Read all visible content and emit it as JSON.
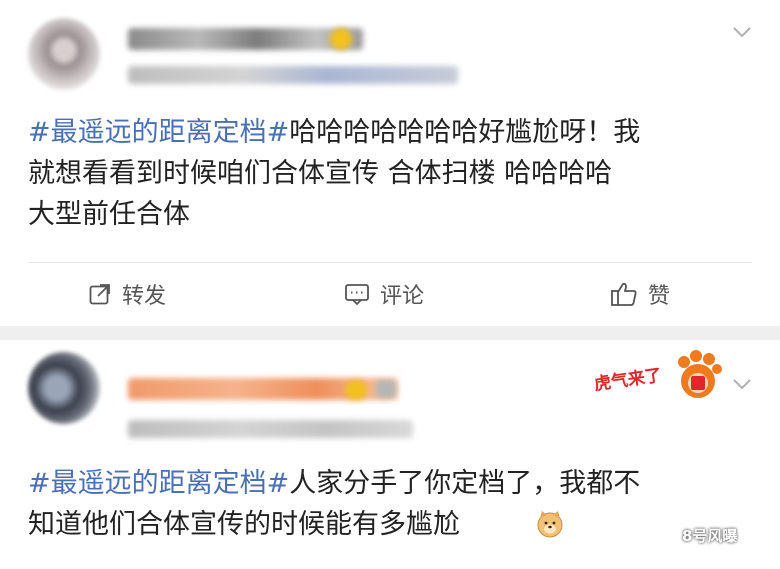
{
  "post1": {
    "text_tag": "#最遥远的距离定档#",
    "text_line1_rest": "哈哈哈哈哈哈哈好尴尬呀！我",
    "text_line2": "就想看看到时候咱们合体宣传  合体扫楼 哈哈哈哈",
    "text_line3": "大型前任合体",
    "actions": {
      "repost": "转发",
      "comment": "评论",
      "like": "赞"
    }
  },
  "post2": {
    "text_tag": "#最遥远的距离定档#",
    "text_line1_rest": "人家分手了你定档了，我都不",
    "text_line2": "知道他们合体宣传的时候能有多尴尬",
    "sticker": "虎气来了"
  },
  "watermark": "8号风曝",
  "colors": {
    "hashtag": "#4a6fb5",
    "body_text": "#222222",
    "separator": "#efefef"
  }
}
